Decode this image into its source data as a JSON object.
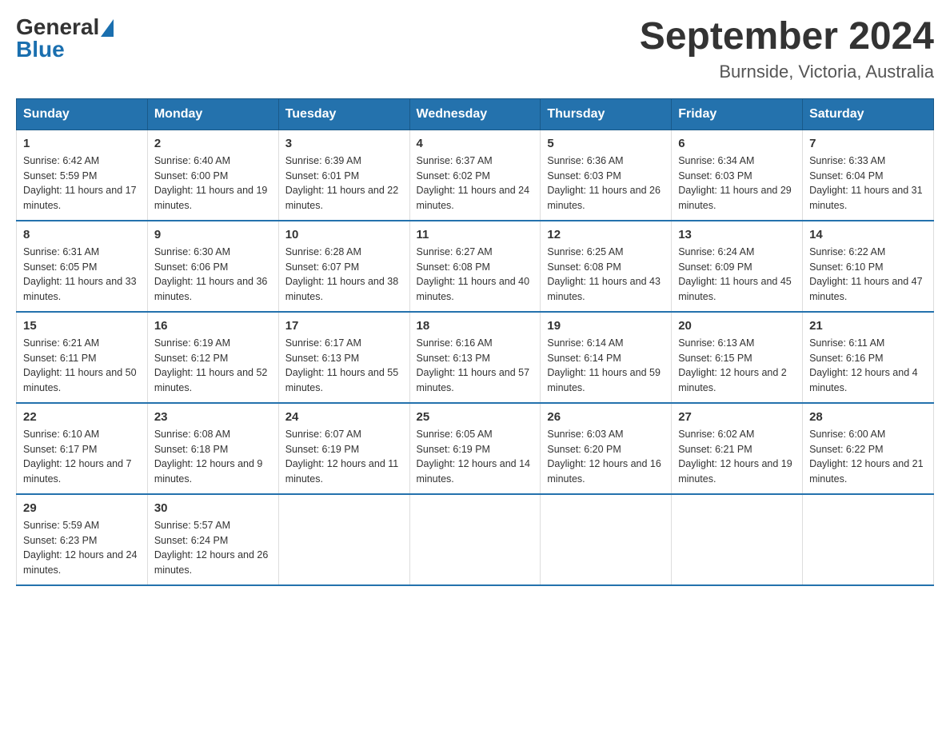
{
  "header": {
    "logo": {
      "general": "General",
      "blue": "Blue"
    },
    "title": "September 2024",
    "subtitle": "Burnside, Victoria, Australia"
  },
  "weekdays": [
    "Sunday",
    "Monday",
    "Tuesday",
    "Wednesday",
    "Thursday",
    "Friday",
    "Saturday"
  ],
  "weeks": [
    [
      {
        "day": "1",
        "sunrise": "6:42 AM",
        "sunset": "5:59 PM",
        "daylight": "11 hours and 17 minutes."
      },
      {
        "day": "2",
        "sunrise": "6:40 AM",
        "sunset": "6:00 PM",
        "daylight": "11 hours and 19 minutes."
      },
      {
        "day": "3",
        "sunrise": "6:39 AM",
        "sunset": "6:01 PM",
        "daylight": "11 hours and 22 minutes."
      },
      {
        "day": "4",
        "sunrise": "6:37 AM",
        "sunset": "6:02 PM",
        "daylight": "11 hours and 24 minutes."
      },
      {
        "day": "5",
        "sunrise": "6:36 AM",
        "sunset": "6:03 PM",
        "daylight": "11 hours and 26 minutes."
      },
      {
        "day": "6",
        "sunrise": "6:34 AM",
        "sunset": "6:03 PM",
        "daylight": "11 hours and 29 minutes."
      },
      {
        "day": "7",
        "sunrise": "6:33 AM",
        "sunset": "6:04 PM",
        "daylight": "11 hours and 31 minutes."
      }
    ],
    [
      {
        "day": "8",
        "sunrise": "6:31 AM",
        "sunset": "6:05 PM",
        "daylight": "11 hours and 33 minutes."
      },
      {
        "day": "9",
        "sunrise": "6:30 AM",
        "sunset": "6:06 PM",
        "daylight": "11 hours and 36 minutes."
      },
      {
        "day": "10",
        "sunrise": "6:28 AM",
        "sunset": "6:07 PM",
        "daylight": "11 hours and 38 minutes."
      },
      {
        "day": "11",
        "sunrise": "6:27 AM",
        "sunset": "6:08 PM",
        "daylight": "11 hours and 40 minutes."
      },
      {
        "day": "12",
        "sunrise": "6:25 AM",
        "sunset": "6:08 PM",
        "daylight": "11 hours and 43 minutes."
      },
      {
        "day": "13",
        "sunrise": "6:24 AM",
        "sunset": "6:09 PM",
        "daylight": "11 hours and 45 minutes."
      },
      {
        "day": "14",
        "sunrise": "6:22 AM",
        "sunset": "6:10 PM",
        "daylight": "11 hours and 47 minutes."
      }
    ],
    [
      {
        "day": "15",
        "sunrise": "6:21 AM",
        "sunset": "6:11 PM",
        "daylight": "11 hours and 50 minutes."
      },
      {
        "day": "16",
        "sunrise": "6:19 AM",
        "sunset": "6:12 PM",
        "daylight": "11 hours and 52 minutes."
      },
      {
        "day": "17",
        "sunrise": "6:17 AM",
        "sunset": "6:13 PM",
        "daylight": "11 hours and 55 minutes."
      },
      {
        "day": "18",
        "sunrise": "6:16 AM",
        "sunset": "6:13 PM",
        "daylight": "11 hours and 57 minutes."
      },
      {
        "day": "19",
        "sunrise": "6:14 AM",
        "sunset": "6:14 PM",
        "daylight": "11 hours and 59 minutes."
      },
      {
        "day": "20",
        "sunrise": "6:13 AM",
        "sunset": "6:15 PM",
        "daylight": "12 hours and 2 minutes."
      },
      {
        "day": "21",
        "sunrise": "6:11 AM",
        "sunset": "6:16 PM",
        "daylight": "12 hours and 4 minutes."
      }
    ],
    [
      {
        "day": "22",
        "sunrise": "6:10 AM",
        "sunset": "6:17 PM",
        "daylight": "12 hours and 7 minutes."
      },
      {
        "day": "23",
        "sunrise": "6:08 AM",
        "sunset": "6:18 PM",
        "daylight": "12 hours and 9 minutes."
      },
      {
        "day": "24",
        "sunrise": "6:07 AM",
        "sunset": "6:19 PM",
        "daylight": "12 hours and 11 minutes."
      },
      {
        "day": "25",
        "sunrise": "6:05 AM",
        "sunset": "6:19 PM",
        "daylight": "12 hours and 14 minutes."
      },
      {
        "day": "26",
        "sunrise": "6:03 AM",
        "sunset": "6:20 PM",
        "daylight": "12 hours and 16 minutes."
      },
      {
        "day": "27",
        "sunrise": "6:02 AM",
        "sunset": "6:21 PM",
        "daylight": "12 hours and 19 minutes."
      },
      {
        "day": "28",
        "sunrise": "6:00 AM",
        "sunset": "6:22 PM",
        "daylight": "12 hours and 21 minutes."
      }
    ],
    [
      {
        "day": "29",
        "sunrise": "5:59 AM",
        "sunset": "6:23 PM",
        "daylight": "12 hours and 24 minutes."
      },
      {
        "day": "30",
        "sunrise": "5:57 AM",
        "sunset": "6:24 PM",
        "daylight": "12 hours and 26 minutes."
      },
      null,
      null,
      null,
      null,
      null
    ]
  ]
}
